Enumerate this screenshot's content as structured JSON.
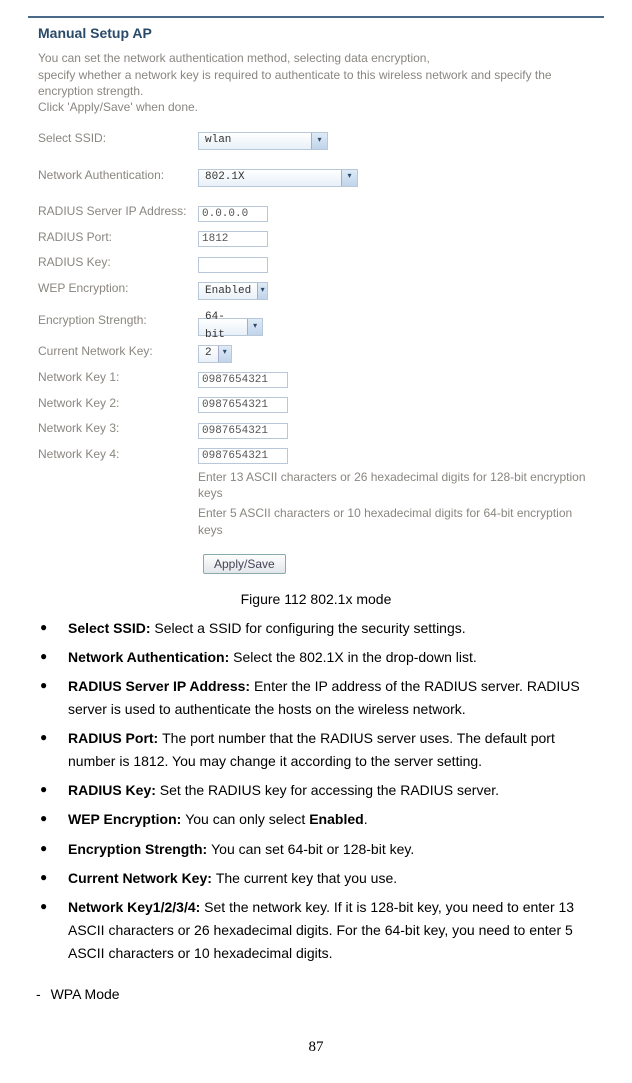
{
  "screenshot": {
    "title": "Manual Setup AP",
    "intro_line1": "You can set the network authentication method, selecting data encryption,",
    "intro_line2": "specify whether a network key is required to authenticate to this wireless network and specify the encryption strength.",
    "intro_line3": "Click 'Apply/Save' when done.",
    "fields": {
      "select_ssid_label": "Select SSID:",
      "select_ssid_value": "wlan",
      "net_auth_label": "Network Authentication:",
      "net_auth_value": "802.1X",
      "radius_ip_label": "RADIUS Server IP Address:",
      "radius_ip_value": "0.0.0.0",
      "radius_port_label": "RADIUS Port:",
      "radius_port_value": "1812",
      "radius_key_label": "RADIUS Key:",
      "radius_key_value": "",
      "wep_enc_label": "WEP Encryption:",
      "wep_enc_value": "Enabled",
      "enc_strength_label": "Encryption Strength:",
      "enc_strength_value": "64-bit",
      "cur_key_label": "Current Network Key:",
      "cur_key_value": "2",
      "nk1_label": "Network Key 1:",
      "nk1_value": "0987654321",
      "nk2_label": "Network Key 2:",
      "nk2_value": "0987654321",
      "nk3_label": "Network Key 3:",
      "nk3_value": "0987654321",
      "nk4_label": "Network Key 4:",
      "nk4_value": "0987654321"
    },
    "hint1": "Enter 13 ASCII characters or 26 hexadecimal digits for 128-bit encryption keys",
    "hint2": "Enter 5 ASCII characters or 10 hexadecimal digits for 64-bit encryption keys",
    "apply_btn": "Apply/Save"
  },
  "figure_caption": "Figure 112 802.1x mode",
  "bullets": [
    {
      "head": "Select SSID: ",
      "body": "Select a SSID for configuring the security settings."
    },
    {
      "head": "Network Authentication: ",
      "body": "Select the 802.1X in the drop-down list."
    },
    {
      "head": "RADIUS Server IP Address: ",
      "body": "Enter the IP address of the RADIUS server. RADIUS server is used to authenticate the hosts on the wireless network."
    },
    {
      "head": "RADIUS Port: ",
      "body": "The port number that the RADIUS server uses. The default port number is 1812. You may change it according to the server setting."
    },
    {
      "head": "RADIUS Key: ",
      "body": "Set the RADIUS key for accessing the RADIUS server."
    },
    {
      "head": "WEP Encryption: ",
      "body": "You can only select ",
      "tail_bold": "Enabled",
      "tail_after": "."
    },
    {
      "head": "Encryption Strength: ",
      "body": "You can set 64-bit or 128-bit key."
    },
    {
      "head": "Current Network Key: ",
      "body": "The current key that you use."
    },
    {
      "head": "Network Key1/2/3/4: ",
      "body": "Set the network key. If it is 128-bit key, you need to enter 13 ASCII characters or 26 hexadecimal digits. For the 64-bit key, you need to enter 5 ASCII characters or 10 hexadecimal digits."
    }
  ],
  "sub_item": "WPA Mode",
  "page_number": "87"
}
